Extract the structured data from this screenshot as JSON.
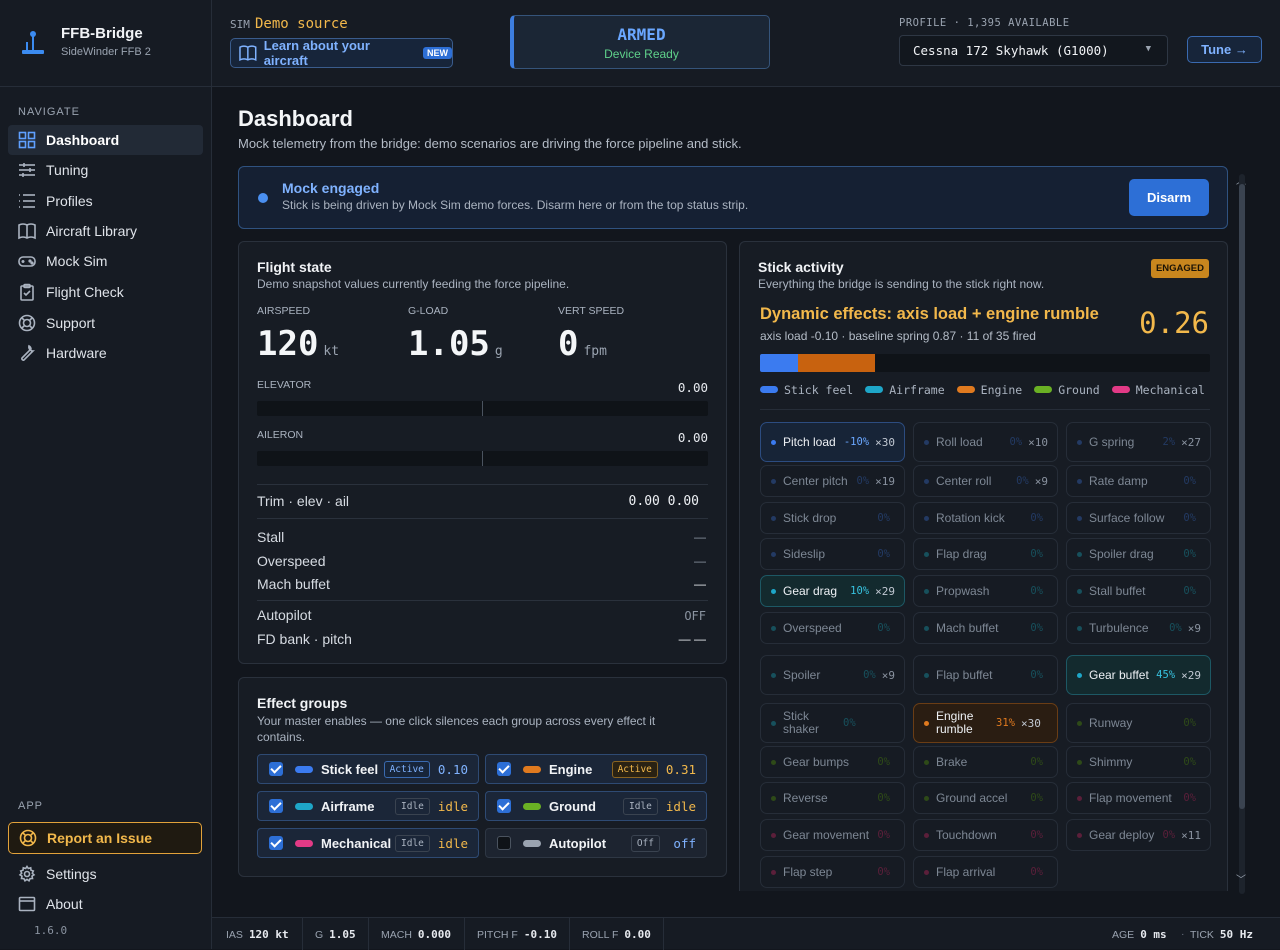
{
  "brand": {
    "title": "FFB-Bridge",
    "subtitle": "SideWinder FFB 2"
  },
  "nav": {
    "section_label": "NAVIGATE",
    "items": [
      {
        "label": "Dashboard",
        "icon": "dashboard-icon"
      },
      {
        "label": "Tuning",
        "icon": "sliders-icon"
      },
      {
        "label": "Profiles",
        "icon": "list-icon"
      },
      {
        "label": "Aircraft Library",
        "icon": "book-icon"
      },
      {
        "label": "Mock Sim",
        "icon": "gamepad-icon"
      },
      {
        "label": "Flight Check",
        "icon": "clipboard-icon"
      },
      {
        "label": "Support",
        "icon": "lifebuoy-icon"
      },
      {
        "label": "Hardware",
        "icon": "wrench-icon"
      }
    ],
    "app_label": "APP",
    "report_label": "Report an Issue",
    "settings_label": "Settings",
    "about_label": "About",
    "version": "1.6.0"
  },
  "topbar": {
    "sim_label": "SIM",
    "sim_value": "Demo source",
    "learn_label": "Learn about your aircraft",
    "new_badge": "NEW",
    "armed_title": "ARMED",
    "armed_sub": "Device Ready",
    "profile_label": "PROFILE · 1,395 AVAILABLE",
    "profile_value": "Cessna 172 Skyhawk (G1000)",
    "tune_label": "Tune →"
  },
  "page": {
    "title": "Dashboard",
    "subtitle": "Mock telemetry from the bridge: demo scenarios are driving the force pipeline and stick."
  },
  "banner": {
    "title": "Mock engaged",
    "subtitle": "Stick is being driven by Mock Sim demo forces. Disarm here or from the top status strip.",
    "button": "Disarm"
  },
  "flight_state": {
    "title": "Flight state",
    "subtitle": "Demo snapshot values currently feeding the force pipeline.",
    "metrics": [
      {
        "label": "AIRSPEED",
        "value": "120",
        "unit": "kt"
      },
      {
        "label": "G-LOAD",
        "value": "1.05",
        "unit": "g"
      },
      {
        "label": "VERT SPEED",
        "value": "0",
        "unit": "fpm"
      }
    ],
    "elevator_label": "ELEVATOR",
    "elevator_value": "0.00",
    "aileron_label": "AILERON",
    "aileron_value": "0.00",
    "trim_label": "Trim · elev · ail",
    "trim_value": "0.00 0.00",
    "rows": [
      {
        "label": "Stall",
        "value": "—"
      },
      {
        "label": "Overspeed",
        "value": "—"
      },
      {
        "label": "Mach buffet",
        "value": "—"
      },
      {
        "label": "Autopilot",
        "value": "OFF"
      },
      {
        "label": "FD bank · pitch",
        "value": "— —"
      }
    ]
  },
  "effect_groups": {
    "title": "Effect groups",
    "subtitle": "Your master enables — one click silences each group across every effect it contains.",
    "items": [
      {
        "name": "Stick feel",
        "state": "Active",
        "value": "0.10",
        "color": "#3b7bf0",
        "checked": true
      },
      {
        "name": "Engine",
        "state": "Active",
        "value": "0.31",
        "color": "#e07a1f",
        "checked": true
      },
      {
        "name": "Airframe",
        "state": "Idle",
        "value": "idle",
        "color": "#1ea6c8",
        "checked": true
      },
      {
        "name": "Ground",
        "state": "Idle",
        "value": "idle",
        "color": "#6ab024",
        "checked": true
      },
      {
        "name": "Mechanical",
        "state": "Idle",
        "value": "idle",
        "color": "#e23a86",
        "checked": true
      },
      {
        "name": "Autopilot",
        "state": "Off",
        "value": "off",
        "color": "#9aa3b0",
        "checked": false
      }
    ]
  },
  "stick": {
    "title": "Stick activity",
    "subtitle": "Everything the bridge is sending to the stick right now.",
    "badge": "ENGAGED",
    "dyn_title": "Dynamic effects: axis load + engine rumble",
    "dyn_sub": "axis load -0.10 · baseline spring 0.87 · 11 of 35 fired",
    "dyn_value": "0.26",
    "stack": [
      {
        "group": "Stick feel",
        "fraction": 0.085,
        "color": "#3b7bf0"
      },
      {
        "group": "Engine",
        "fraction": 0.17,
        "color": "#c8620f"
      }
    ],
    "legend": [
      {
        "label": "Stick feel",
        "color": "#3b7bf0"
      },
      {
        "label": "Airframe",
        "color": "#1ea6c8"
      },
      {
        "label": "Engine",
        "color": "#e07a1f"
      },
      {
        "label": "Ground",
        "color": "#6ab024"
      },
      {
        "label": "Mechanical",
        "color": "#e23a86"
      }
    ],
    "effects": [
      {
        "name": "Pitch load",
        "pct": "-10%",
        "count": "×30",
        "group": "stick",
        "on": true,
        "tall": true
      },
      {
        "name": "Roll load",
        "pct": "0%",
        "count": "×10",
        "group": "stick"
      },
      {
        "name": "G spring",
        "pct": "2%",
        "count": "×27",
        "group": "stick"
      },
      {
        "name": "Center pitch",
        "pct": "0%",
        "count": "×19",
        "group": "stick"
      },
      {
        "name": "Center roll",
        "pct": "0%",
        "count": "×9",
        "group": "stick"
      },
      {
        "name": "Rate damp",
        "pct": "0%",
        "count": "",
        "group": "stick"
      },
      {
        "name": "Stick drop",
        "pct": "0%",
        "count": "",
        "group": "stick"
      },
      {
        "name": "Rotation kick",
        "pct": "0%",
        "count": "",
        "group": "stick"
      },
      {
        "name": "Surface follow",
        "pct": "0%",
        "count": "",
        "group": "stick"
      },
      {
        "name": "Sideslip",
        "pct": "0%",
        "count": "",
        "group": "stick"
      },
      {
        "name": "Flap drag",
        "pct": "0%",
        "count": "",
        "group": "air"
      },
      {
        "name": "Spoiler drag",
        "pct": "0%",
        "count": "",
        "group": "air"
      },
      {
        "name": "Gear drag",
        "pct": "10%",
        "count": "×29",
        "group": "air",
        "on": true
      },
      {
        "name": "Propwash",
        "pct": "0%",
        "count": "",
        "group": "air"
      },
      {
        "name": "Stall buffet",
        "pct": "0%",
        "count": "",
        "group": "air"
      },
      {
        "name": "Overspeed",
        "pct": "0%",
        "count": "",
        "group": "air"
      },
      {
        "name": "Mach buffet",
        "pct": "0%",
        "count": "",
        "group": "air"
      },
      {
        "name": "Turbulence",
        "pct": "0%",
        "count": "×9",
        "group": "air"
      },
      {
        "name": "Spoiler",
        "pct": "0%",
        "count": "×9",
        "group": "air",
        "tall": true
      },
      {
        "name": "Flap buffet",
        "pct": "0%",
        "count": "",
        "group": "air",
        "tall": true
      },
      {
        "name": "Gear buffet",
        "pct": "45%",
        "count": "×29",
        "group": "air",
        "on": true,
        "tall": true
      },
      {
        "name": "Stick shaker",
        "pct": "0%",
        "count": "",
        "group": "air",
        "tall": true
      },
      {
        "name": "Engine rumble",
        "pct": "31%",
        "count": "×30",
        "group": "eng",
        "on": true,
        "tall": true
      },
      {
        "name": "Runway",
        "pct": "0%",
        "count": "",
        "group": "gnd",
        "tall": true
      },
      {
        "name": "Gear bumps",
        "pct": "0%",
        "count": "",
        "group": "gnd"
      },
      {
        "name": "Brake",
        "pct": "0%",
        "count": "",
        "group": "gnd"
      },
      {
        "name": "Shimmy",
        "pct": "0%",
        "count": "",
        "group": "gnd"
      },
      {
        "name": "Reverse",
        "pct": "0%",
        "count": "",
        "group": "gnd"
      },
      {
        "name": "Ground accel",
        "pct": "0%",
        "count": "",
        "group": "gnd"
      },
      {
        "name": "Flap movement",
        "pct": "0%",
        "count": "",
        "group": "mech"
      },
      {
        "name": "Gear movement",
        "pct": "0%",
        "count": "",
        "group": "mech"
      },
      {
        "name": "Touchdown",
        "pct": "0%",
        "count": "",
        "group": "mech"
      },
      {
        "name": "Gear deploy",
        "pct": "0%",
        "count": "×11",
        "group": "mech"
      },
      {
        "name": "Flap step",
        "pct": "0%",
        "count": "",
        "group": "mech"
      },
      {
        "name": "Flap arrival",
        "pct": "0%",
        "count": "",
        "group": "mech"
      }
    ]
  },
  "status": {
    "ias_label": "IAS",
    "ias": "120 kt",
    "g_label": "G",
    "g": "1.05",
    "mach_label": "MACH",
    "mach": "0.000",
    "pitchf_label": "PITCH F",
    "pitchf": "-0.10",
    "rollf_label": "ROLL F",
    "rollf": "0.00",
    "age_label": "AGE",
    "age": "0 ms",
    "tick_label": "TICK",
    "tick": "50 Hz"
  }
}
